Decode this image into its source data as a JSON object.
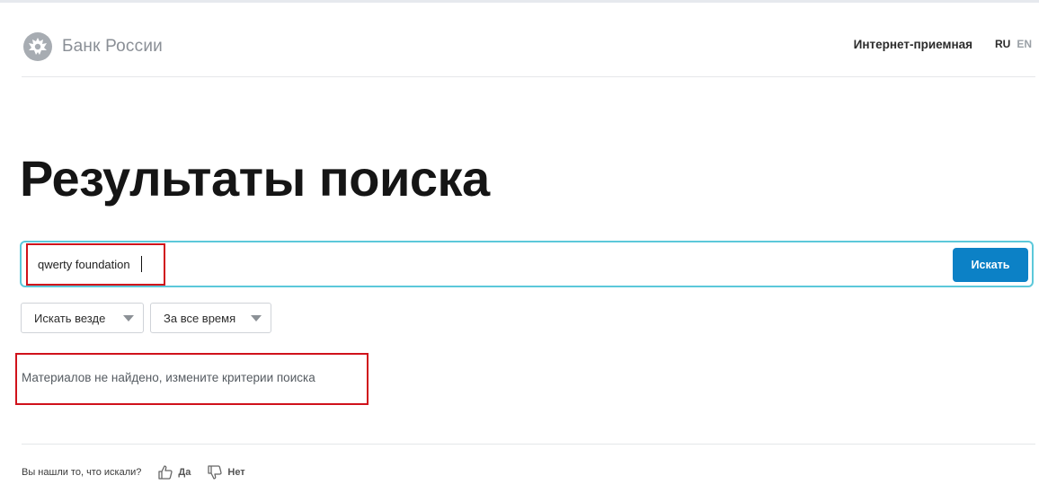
{
  "header": {
    "logo_text": "Банк России",
    "link": "Интернет-приемная",
    "lang_active": "RU",
    "lang_other": "EN"
  },
  "main": {
    "title": "Результаты поиска",
    "search_value": "qwerty foundation",
    "search_button": "Искать",
    "filters": {
      "scope": "Искать везде",
      "period": "За все время"
    },
    "empty_message": "Материалов не найдено, измените критерии поиска"
  },
  "feedback": {
    "question": "Вы нашли то, что искали?",
    "yes": "Да",
    "no": "Нет"
  },
  "colors": {
    "accent": "#0c81c6",
    "search_border": "#5cc8da",
    "highlight": "#d0121b"
  },
  "icons": {
    "logo": "double-headed-eagle-icon",
    "filter_arrow": "triangle-down-icon",
    "yes": "thumbs-up-icon",
    "no": "thumbs-down-icon"
  }
}
